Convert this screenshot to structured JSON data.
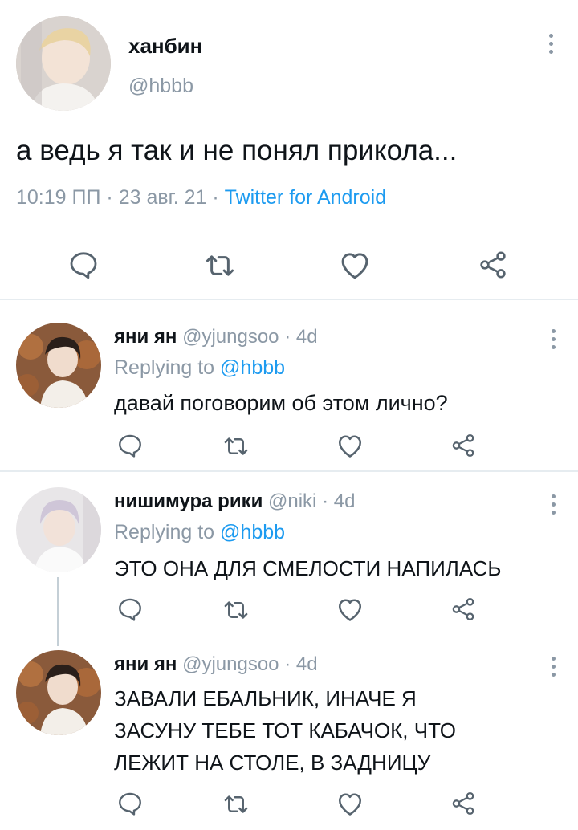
{
  "tweet": {
    "author_name": "ханбин",
    "author_handle": "@hbbb",
    "text": "а ведь я так и не понял прикола...",
    "time": "10:19 ПП",
    "sep1": "·",
    "date": "23 авг. 21",
    "sep2": "·",
    "source": "Twitter for Android"
  },
  "replies": [
    {
      "author_name": "яни ян",
      "author_handle": "@yjungsoo",
      "sep": "·",
      "age": "4d",
      "replying_label": "Replying to",
      "replying_to": "@hbbb",
      "text_lines": [
        "давай поговорим об этом лично?"
      ]
    },
    {
      "author_name": "нишимура рики",
      "author_handle": "@niki",
      "sep": "·",
      "age": "4d",
      "replying_label": "Replying to",
      "replying_to": "@hbbb",
      "text_lines": [
        "ЭТО ОНА ДЛЯ СМЕЛОСТИ НАПИЛАСЬ"
      ]
    },
    {
      "author_name": "яни ян",
      "author_handle": "@yjungsoo",
      "sep": "·",
      "age": "4d",
      "text_lines": [
        "ЗАВАЛИ ЕБАЛЬНИК, ИНАЧЕ Я",
        "ЗАСУНУ ТЕБЕ ТОТ КАБАЧОК, ЧТО",
        "ЛЕЖИТ НА СТОЛЕ, В ЗАДНИЦУ"
      ]
    }
  ],
  "icons": {
    "reply": "reply-icon",
    "retweet": "retweet-icon",
    "like": "heart-icon",
    "share": "share-icon",
    "more": "more-options-icon"
  },
  "colors": {
    "text": "#0f1419",
    "muted": "#8b98a5",
    "link": "#1d9bf0",
    "divider": "#e6ecf0",
    "thread_line": "#c4cfd6"
  }
}
